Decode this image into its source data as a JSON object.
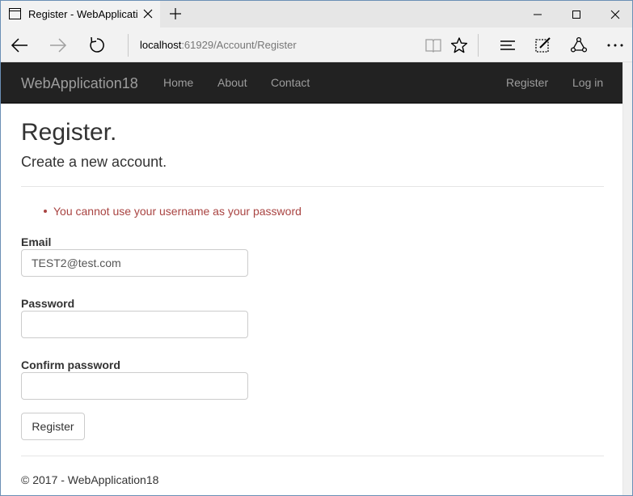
{
  "browser": {
    "tab_title": "Register - WebApplicati",
    "address_host": "localhost",
    "address_rest": ":61929/Account/Register",
    "icons": [
      "page-icon",
      "tab-close-icon",
      "new-tab-icon",
      "minimize-icon",
      "maximize-icon",
      "window-close-icon",
      "back-icon",
      "forward-icon",
      "refresh-icon",
      "reading-view-icon",
      "favorite-star-icon",
      "hub-icon",
      "web-note-icon",
      "share-icon",
      "more-icon"
    ]
  },
  "site": {
    "brand": "WebApplication18",
    "nav": [
      "Home",
      "About",
      "Contact"
    ],
    "nav_right": [
      "Register",
      "Log in"
    ],
    "colors": {
      "navbar_bg": "#222222",
      "nav_text": "#9d9d9d",
      "error": "#a94442"
    }
  },
  "page": {
    "title": "Register.",
    "subtitle": "Create a new account.",
    "validation_errors": [
      "You cannot use your username as your password"
    ],
    "form": {
      "email_label": "Email",
      "email_value": "TEST2@test.com",
      "password_label": "Password",
      "password_value": "",
      "confirm_label": "Confirm password",
      "confirm_value": "",
      "submit_label": "Register"
    },
    "footer": "© 2017 - WebApplication18"
  }
}
